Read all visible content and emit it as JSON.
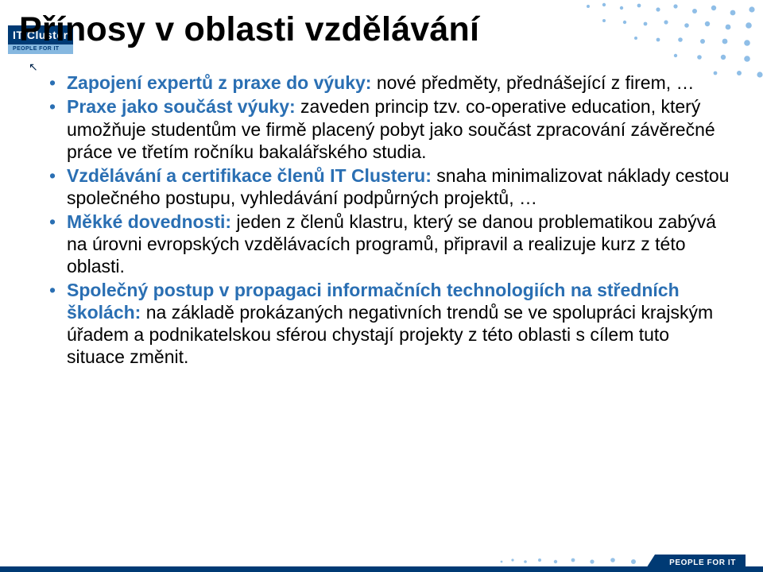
{
  "logo": {
    "main": "IT Cluster",
    "sub": "PEOPLE FOR IT"
  },
  "title": "Přínosy v oblasti vzdělávání",
  "bullets": [
    {
      "lead": "Zapojení expertů z praxe do výuky:",
      "rest": " nové předměty, přednášející z firem, …"
    },
    {
      "lead": "Praxe jako součást výuky:",
      "rest": " zaveden princip tzv. co-operative education, který umožňuje studentům ve firmě placený pobyt jako součást zpracování závěrečné práce ve třetím ročníku bakalářského studia."
    },
    {
      "lead": "Vzdělávání a certifikace členů IT Clusteru:",
      "rest": " snaha minimalizovat náklady cestou společného postupu, vyhledávání podpůrných projektů, …"
    },
    {
      "lead": "Měkké dovednosti:",
      "rest": " jeden z členů klastru, který se danou problematikou zabývá na úrovni evropských vzdělávacích programů, připravil a realizuje kurz z této oblasti."
    },
    {
      "lead": "Společný postup v propagaci informačních technologiích na středních školách:",
      "rest": " na základě prokázaných negativních trendů se ve spolupráci krajským úřadem a podnikatelskou sférou chystají projekty z této oblasti s cílem tuto situace změnit."
    }
  ],
  "footer": {
    "badge": "PEOPLE FOR IT"
  }
}
